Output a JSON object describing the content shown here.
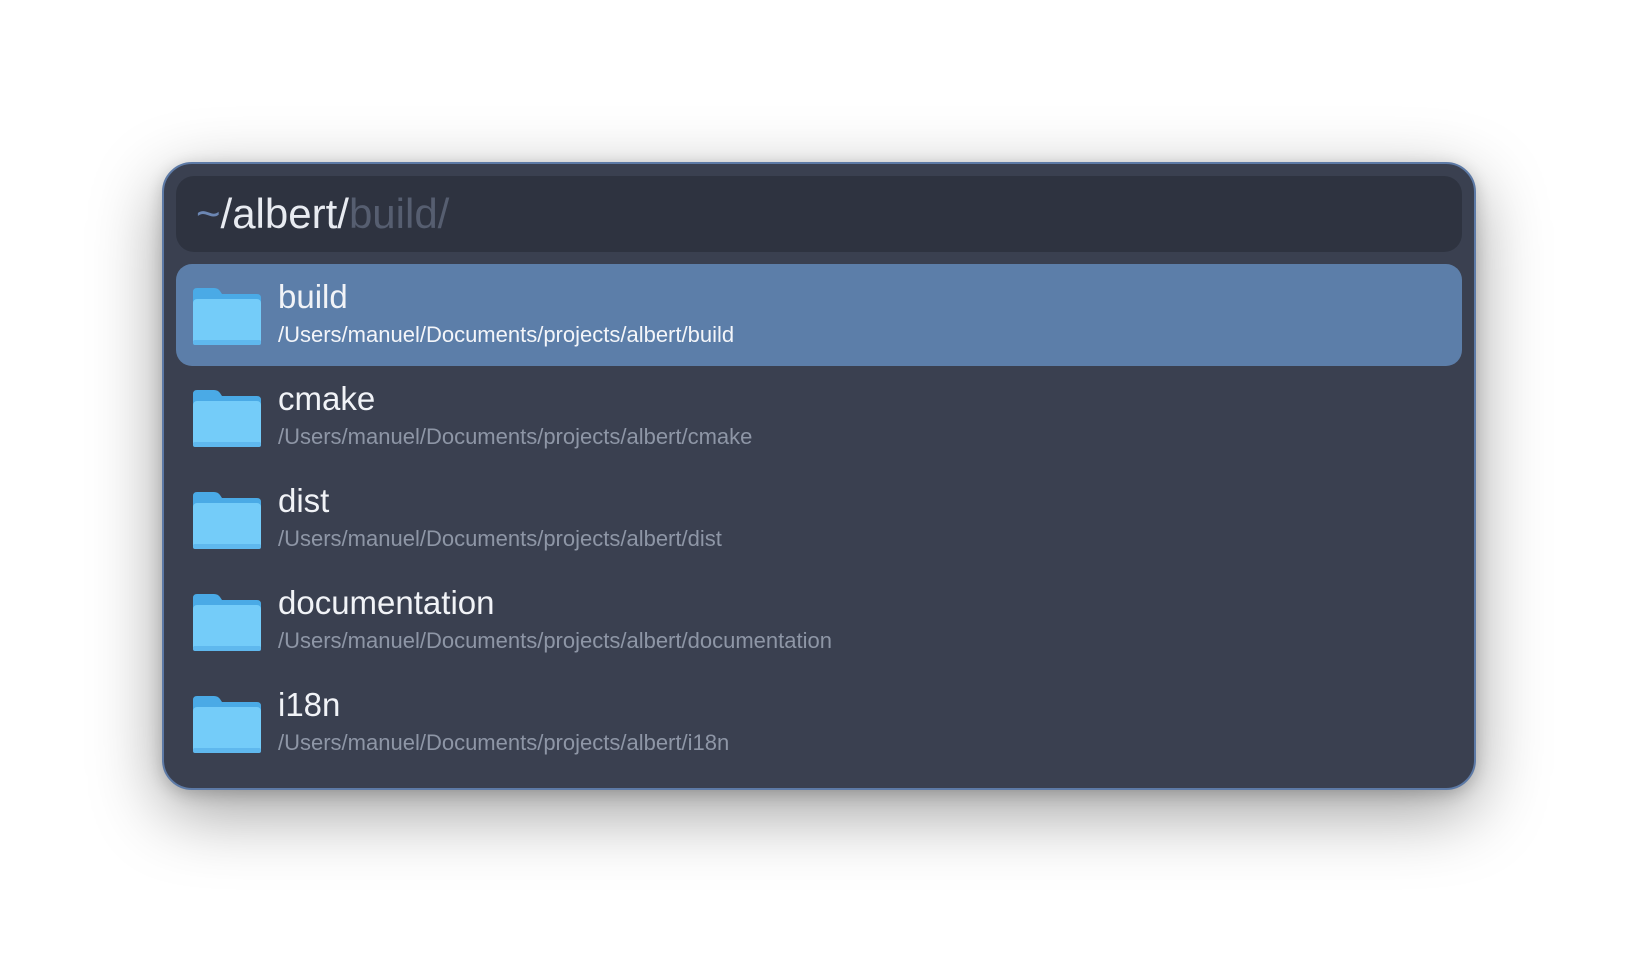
{
  "query": {
    "prefix": "~",
    "typed": "/albert/",
    "completion": "build/"
  },
  "results": [
    {
      "title": "build",
      "subtitle": "/Users/manuel/Documents/projects/albert/build",
      "icon": "folder-icon",
      "selected": true
    },
    {
      "title": "cmake",
      "subtitle": "/Users/manuel/Documents/projects/albert/cmake",
      "icon": "folder-icon",
      "selected": false
    },
    {
      "title": "dist",
      "subtitle": "/Users/manuel/Documents/projects/albert/dist",
      "icon": "folder-icon",
      "selected": false
    },
    {
      "title": "documentation",
      "subtitle": "/Users/manuel/Documents/projects/albert/documentation",
      "icon": "folder-icon",
      "selected": false
    },
    {
      "title": "i18n",
      "subtitle": "/Users/manuel/Documents/projects/albert/i18n",
      "icon": "folder-icon",
      "selected": false
    }
  ],
  "colors": {
    "panel": "#3a4050",
    "search_bg": "#2e3340",
    "selection": "#5c7ea9",
    "accent": "#6c87b4",
    "folder_front": "#74ccf9",
    "folder_back": "#4aaae6"
  }
}
